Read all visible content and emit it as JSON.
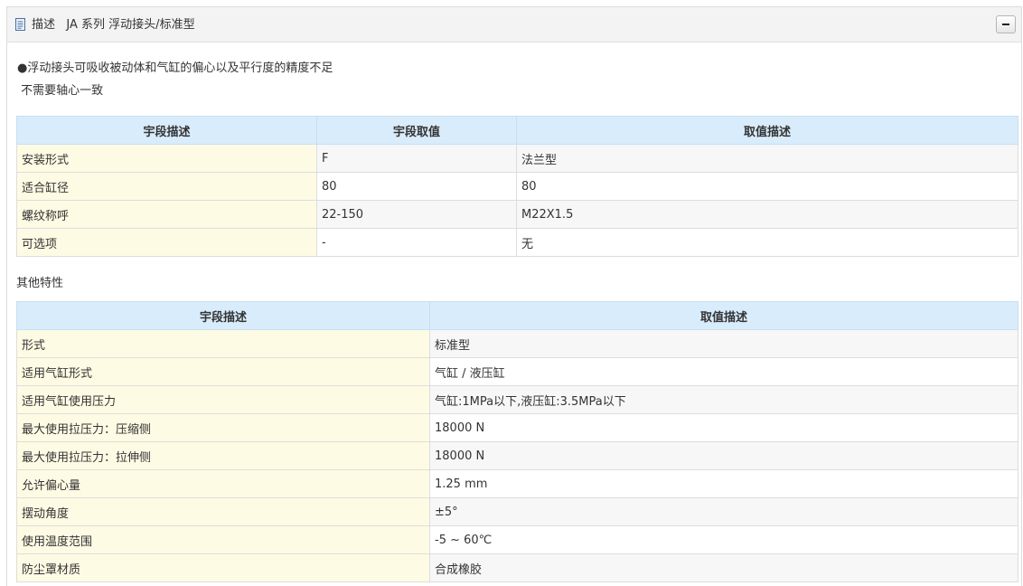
{
  "header": {
    "title_label": "描述",
    "title_text": "JA 系列 浮动接头/标准型",
    "collapse_symbol": "−"
  },
  "description": {
    "line1": "●浮动接头可吸收被动体和气缸的偏心以及平行度的精度不足",
    "line2": " 不需要轴心一致"
  },
  "spec_table": {
    "headers": [
      "宇段描述",
      "宇段取值",
      "取值描述"
    ],
    "rows": [
      [
        "安装形式",
        "F",
        "法兰型"
      ],
      [
        "适合缸径",
        "80",
        "80"
      ],
      [
        "螺纹称呼",
        "22-150",
        "M22X1.5"
      ],
      [
        "可选项",
        "-",
        "无"
      ]
    ]
  },
  "other_features": {
    "label": "其他特性",
    "headers": [
      "宇段描述",
      "取值描述"
    ],
    "rows": [
      [
        "形式",
        "标准型"
      ],
      [
        "适用气缸形式",
        "气缸 / 液压缸"
      ],
      [
        "适用气缸使用压力",
        "气缸:1MPa以下,液压缸:3.5MPa以下"
      ],
      [
        "最大使用拉压力：压缩侧",
        "18000 N"
      ],
      [
        "最大使用拉压力：拉伸侧",
        "18000 N"
      ],
      [
        "允许偏心量",
        "1.25 mm"
      ],
      [
        "摆动角度",
        "±5°"
      ],
      [
        "使用温度范围",
        "-5 ~ 60℃"
      ],
      [
        "防尘罩材质",
        "合成橡胶"
      ]
    ]
  }
}
